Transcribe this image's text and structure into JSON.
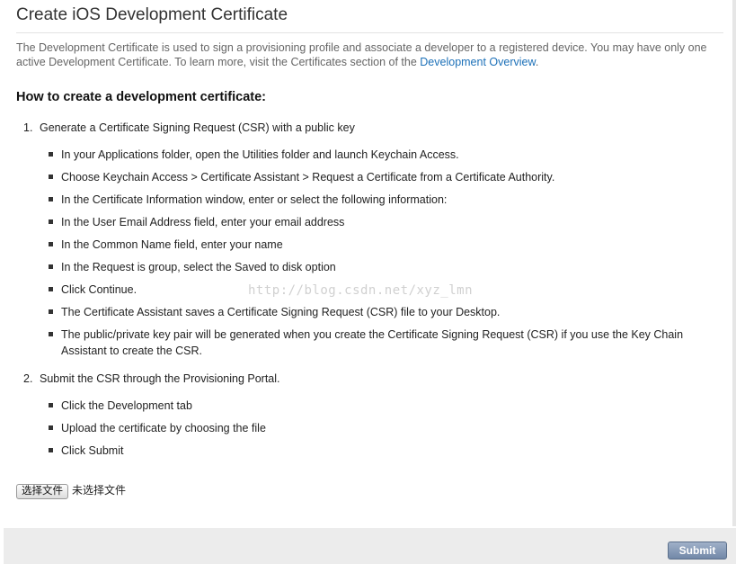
{
  "page": {
    "title": "Create iOS Development Certificate",
    "intro_text": "The Development Certificate is used to sign a provisioning profile and associate a developer to a registered device. You may have only one active Development Certificate. To learn more, visit the Certificates section of the ",
    "intro_link": "Development Overview",
    "intro_end": ".",
    "section_heading": "How to create a development certificate:"
  },
  "steps": [
    {
      "number": "1.",
      "label": "Generate a Certificate Signing Request (CSR) with a public key",
      "bullets": [
        "In your Applications folder, open the Utilities folder and launch Keychain Access.",
        "Choose Keychain Access > Certificate Assistant > Request a Certificate from a Certificate Authority.",
        "In the Certificate Information window, enter or select the following information:",
        "In the User Email Address field, enter your email address",
        "In the Common Name field, enter your name",
        "In the Request is group, select the Saved to disk option",
        "Click Continue.",
        "The Certificate Assistant saves a Certificate Signing Request (CSR) file to your Desktop.",
        "The public/private key pair will be generated when you create the Certificate Signing Request (CSR) if you use the Key Chain Assistant to create the CSR."
      ]
    },
    {
      "number": "2.",
      "label": "Submit the CSR through the Provisioning Portal.",
      "bullets": [
        "Click the Development tab",
        "Upload the certificate by choosing the file",
        "Click Submit"
      ]
    }
  ],
  "file_input": {
    "button_label": "选择文件",
    "status_text": "未选择文件"
  },
  "footer": {
    "submit_label": "Submit"
  },
  "watermark": "http://blog.csdn.net/xyz_lmn"
}
